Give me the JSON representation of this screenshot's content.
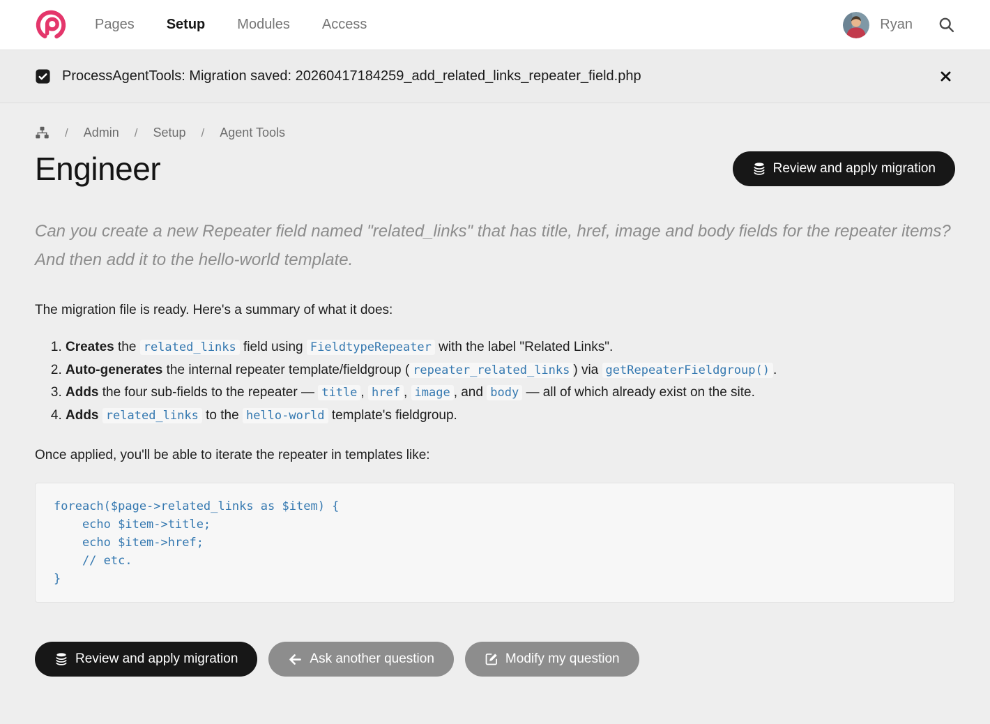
{
  "nav": {
    "items": [
      {
        "label": "Pages"
      },
      {
        "label": "Setup",
        "active": true
      },
      {
        "label": "Modules"
      },
      {
        "label": "Access"
      }
    ],
    "user": "Ryan"
  },
  "notification": {
    "text": "ProcessAgentTools: Migration saved: 20260417184259_add_related_links_repeater_field.php"
  },
  "breadcrumb": {
    "separator": "/",
    "items": [
      "Admin",
      "Setup",
      "Agent Tools"
    ]
  },
  "page": {
    "title": "Engineer"
  },
  "question": "Can you create a new Repeater field named \"related_links\" that has title, href, image and body fields for the repeater items? And then add it to the hello-world template.",
  "summary_intro": "The migration file is ready. Here's a summary of what it does:",
  "list": [
    {
      "segments": [
        {
          "t": "b",
          "v": "Creates"
        },
        {
          "t": "t",
          "v": " the "
        },
        {
          "t": "c",
          "v": "related_links"
        },
        {
          "t": "t",
          "v": " field using "
        },
        {
          "t": "c",
          "v": "FieldtypeRepeater"
        },
        {
          "t": "t",
          "v": " with the label \"Related Links\"."
        }
      ]
    },
    {
      "segments": [
        {
          "t": "b",
          "v": "Auto-generates"
        },
        {
          "t": "t",
          "v": " the internal repeater template/fieldgroup ("
        },
        {
          "t": "c",
          "v": "repeater_related_links"
        },
        {
          "t": "t",
          "v": ") via "
        },
        {
          "t": "c",
          "v": "getRepeaterFieldgroup()"
        },
        {
          "t": "t",
          "v": "."
        }
      ]
    },
    {
      "segments": [
        {
          "t": "b",
          "v": "Adds"
        },
        {
          "t": "t",
          "v": " the four sub-fields to the repeater — "
        },
        {
          "t": "c",
          "v": "title"
        },
        {
          "t": "t",
          "v": ", "
        },
        {
          "t": "c",
          "v": "href"
        },
        {
          "t": "t",
          "v": ", "
        },
        {
          "t": "c",
          "v": "image"
        },
        {
          "t": "t",
          "v": ", and "
        },
        {
          "t": "c",
          "v": "body"
        },
        {
          "t": "t",
          "v": " — all of which already exist on the site."
        }
      ]
    },
    {
      "segments": [
        {
          "t": "b",
          "v": "Adds"
        },
        {
          "t": "t",
          "v": " "
        },
        {
          "t": "c",
          "v": "related_links"
        },
        {
          "t": "t",
          "v": " to the "
        },
        {
          "t": "c",
          "v": "hello-world"
        },
        {
          "t": "t",
          "v": " template's fieldgroup."
        }
      ]
    }
  ],
  "once_text": "Once applied, you'll be able to iterate the repeater in templates like:",
  "code": "foreach($page->related_links as $item) {\n    echo $item->title;\n    echo $item->href;\n    // etc.\n}",
  "buttons": {
    "review": "Review and apply migration",
    "ask": "Ask another question",
    "modify": "Modify my question"
  },
  "colors": {
    "brand": "#e4366b",
    "code_blue": "#3478b0",
    "button_dark": "#171717",
    "button_gray": "#8d8d8d",
    "page_bg": "#eeeeee"
  }
}
